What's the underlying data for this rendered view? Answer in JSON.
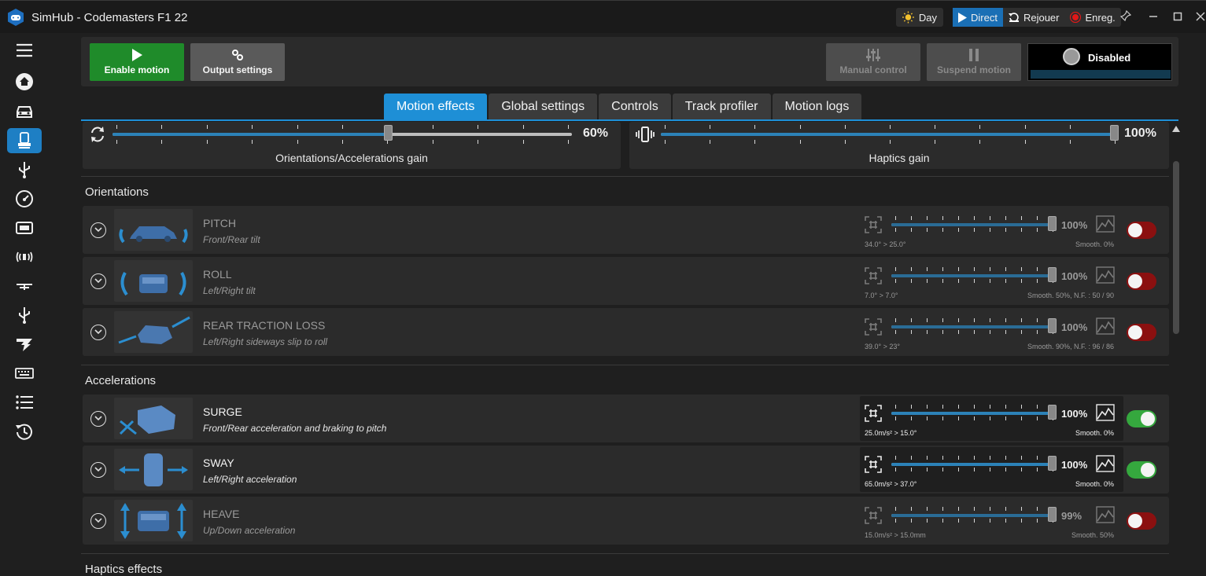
{
  "window": {
    "title": "SimHub - Codemasters F1 22",
    "day_label": "Day",
    "direct_label": "Direct",
    "replay_label": "Rejouer",
    "record_label": "Enreg."
  },
  "sidebar": {
    "items": [
      {
        "icon": "menu-icon"
      },
      {
        "icon": "home-icon"
      },
      {
        "icon": "car-icon"
      },
      {
        "icon": "motion-seat-icon",
        "active": true
      },
      {
        "icon": "usb-icon"
      },
      {
        "icon": "gauge-icon"
      },
      {
        "icon": "dash-display-icon"
      },
      {
        "icon": "shaker-icon"
      },
      {
        "icon": "wind-fan-icon"
      },
      {
        "icon": "usb-device-icon"
      },
      {
        "icon": "arduino-icon"
      },
      {
        "icon": "keyboard-icon"
      },
      {
        "icon": "list-icon"
      },
      {
        "icon": "history-icon"
      }
    ]
  },
  "toolbar": {
    "enable_motion": "Enable motion",
    "output_settings": "Output settings",
    "manual_control": "Manual control",
    "suspend_motion": "Suspend motion",
    "status": "Disabled"
  },
  "tabs": [
    "Motion effects",
    "Global settings",
    "Controls",
    "Track profiler",
    "Motion logs"
  ],
  "gains": {
    "orientation": {
      "label": "Orientations/Accelerations gain",
      "value_text": "60%",
      "value": 0.6
    },
    "haptics": {
      "label": "Haptics gain",
      "value_text": "100%",
      "value": 1.0
    }
  },
  "sections": {
    "orientations": "Orientations",
    "accelerations": "Accelerations",
    "haptics": "Haptics effects"
  },
  "effects": [
    {
      "name": "PITCH",
      "desc": "Front/Rear tilt",
      "pct": "100%",
      "level": 1.0,
      "range": "34.0° > 25.0°",
      "smooth": "Smooth. 0%",
      "enabled": false
    },
    {
      "name": "ROLL",
      "desc": "Left/Right tilt",
      "pct": "100%",
      "level": 1.0,
      "range": "7.0° > 7.0°",
      "smooth": "Smooth. 50%, N.F. : 50 / 90",
      "enabled": false
    },
    {
      "name": "REAR TRACTION LOSS",
      "desc": "Left/Right sideways slip to roll",
      "pct": "100%",
      "level": 1.0,
      "range": "39.0° > 23°",
      "smooth": "Smooth. 90%, N.F. : 96 / 86",
      "enabled": false
    },
    {
      "name": "SURGE",
      "desc": "Front/Rear acceleration and braking to pitch",
      "pct": "100%",
      "level": 1.0,
      "range": "25.0m/s² > 15.0°",
      "smooth": "Smooth. 0%",
      "enabled": true
    },
    {
      "name": "SWAY",
      "desc": "Left/Right acceleration",
      "pct": "100%",
      "level": 1.0,
      "range": "65.0m/s² > 37.0°",
      "smooth": "Smooth. 0%",
      "enabled": true
    },
    {
      "name": "HEAVE",
      "desc": "Up/Down acceleration",
      "pct": "99%",
      "level": 0.99,
      "range": "15.0m/s² > 15.0mm",
      "smooth": "Smooth. 50%",
      "enabled": false
    }
  ],
  "colors": {
    "accent": "#1e8fd6",
    "enable_green": "#1f8b2a",
    "toggle_on": "#35a83e",
    "toggle_off": "#8b1010"
  }
}
